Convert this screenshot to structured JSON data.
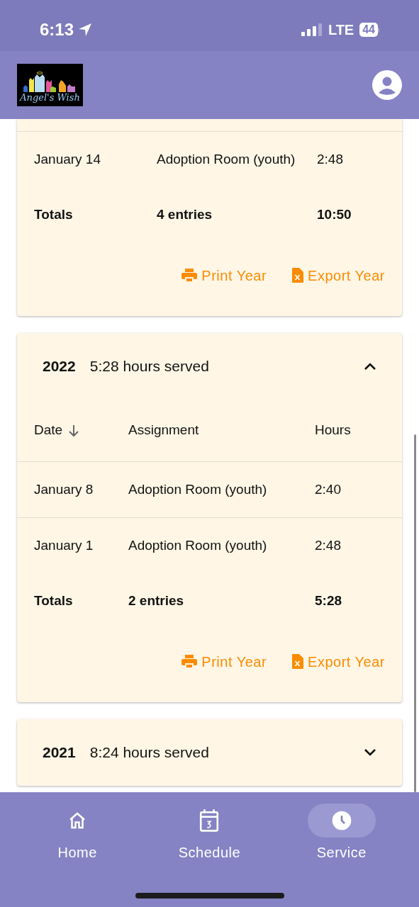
{
  "status_bar": {
    "time": "6:13",
    "network": "LTE",
    "battery": "44"
  },
  "header": {
    "logo_text": "Angel's Wish"
  },
  "cards": [
    {
      "rows": [
        {
          "date": "January 14",
          "assignment": "Adoption Room (youth)",
          "hours": "2:48"
        }
      ],
      "totals": {
        "label": "Totals",
        "entries": "4 entries",
        "hours": "10:50"
      },
      "actions": [
        {
          "kind": "print",
          "label": "Print Year"
        },
        {
          "kind": "export",
          "label": "Export Year"
        }
      ]
    },
    {
      "year": "2022",
      "summary": "5:28 hours served",
      "expanded": true,
      "columns": [
        {
          "label": "Date",
          "sorted": true
        },
        {
          "label": "Assignment",
          "sorted": false
        },
        {
          "label": "Hours",
          "sorted": false
        }
      ],
      "rows": [
        {
          "date": "January 8",
          "assignment": "Adoption Room (youth)",
          "hours": "2:40"
        },
        {
          "date": "January 1",
          "assignment": "Adoption Room (youth)",
          "hours": "2:48"
        }
      ],
      "totals": {
        "label": "Totals",
        "entries": "2 entries",
        "hours": "5:28"
      },
      "actions": [
        {
          "kind": "print",
          "label": "Print Year"
        },
        {
          "kind": "export",
          "label": "Export Year"
        }
      ]
    },
    {
      "year": "2021",
      "summary": "8:24 hours served",
      "expanded": false
    }
  ],
  "nav": [
    {
      "kind": "home",
      "label": "Home",
      "selected": false
    },
    {
      "kind": "schedule",
      "label": "Schedule",
      "selected": false
    },
    {
      "kind": "service",
      "label": "Service",
      "selected": true
    }
  ]
}
